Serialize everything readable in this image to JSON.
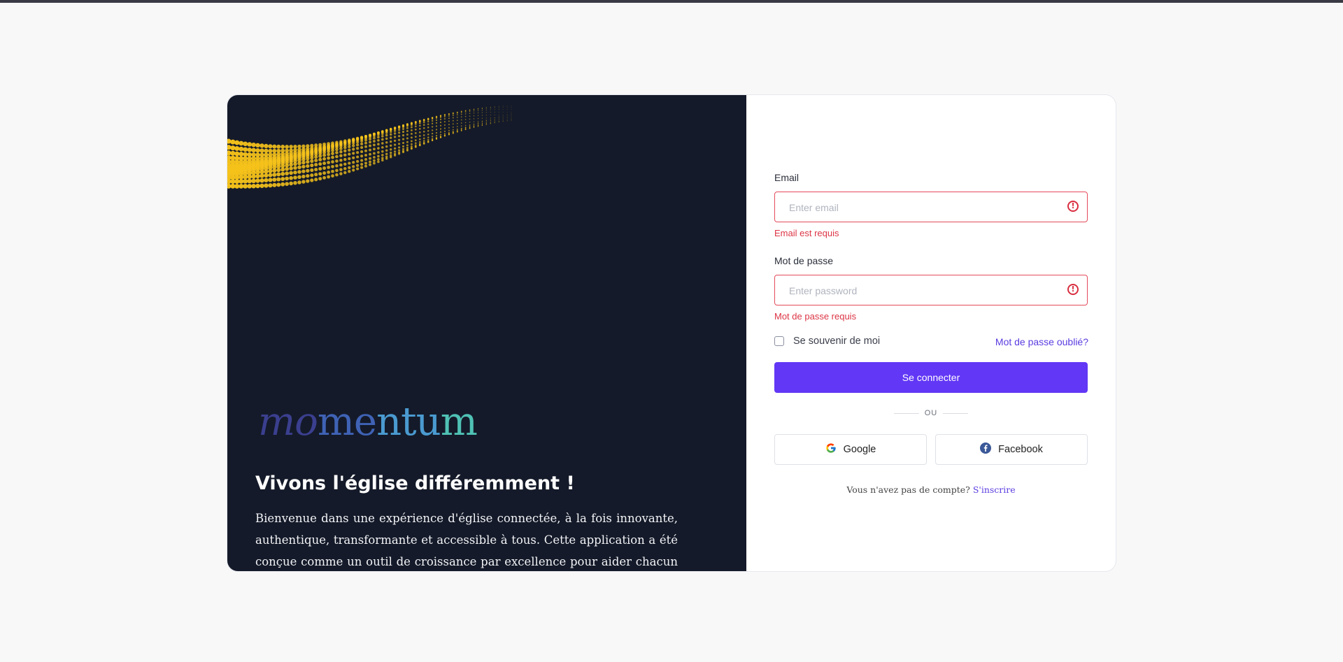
{
  "hero": {
    "logo_parts": [
      "mo",
      "me",
      "ntu",
      "m"
    ],
    "headline": "Vivons l'église différemment !",
    "description": "Bienvenue dans une expérience d'église connectée, à la fois innovante, authentique, transformante et accessible à tous. Cette application a été conçue comme un outil de croissance par excellence pour aider chacun à devenir ce qu'il est appelé à être et à accomplir ses missions. Son objectif est de faciliter le déclenchement de moments décisifs dans la vie de ses utilisateurs pour qu'ils atteignent leur plein potentiel."
  },
  "form": {
    "email": {
      "label": "Email",
      "placeholder": "Enter email",
      "value": "",
      "error": "Email est requis"
    },
    "password": {
      "label": "Mot de passe",
      "placeholder": "Enter password",
      "value": "",
      "error": "Mot de passe requis"
    },
    "remember_label": "Se souvenir de moi",
    "remember_checked": false,
    "forgot_label": "Mot de passe oublié?",
    "submit_label": "Se connecter",
    "divider_label": "OU",
    "google_label": "Google",
    "facebook_label": "Facebook",
    "signup_prompt": "Vous n'avez pas de compte?",
    "signup_link": "S'inscrire"
  },
  "colors": {
    "hero_bg": "#141a29",
    "accent": "#6237f5",
    "error": "#dc3545",
    "wave": "#f5c21b"
  },
  "icons": {
    "error": "exclamation-circle-icon",
    "google": "google-icon",
    "facebook": "facebook-icon"
  }
}
